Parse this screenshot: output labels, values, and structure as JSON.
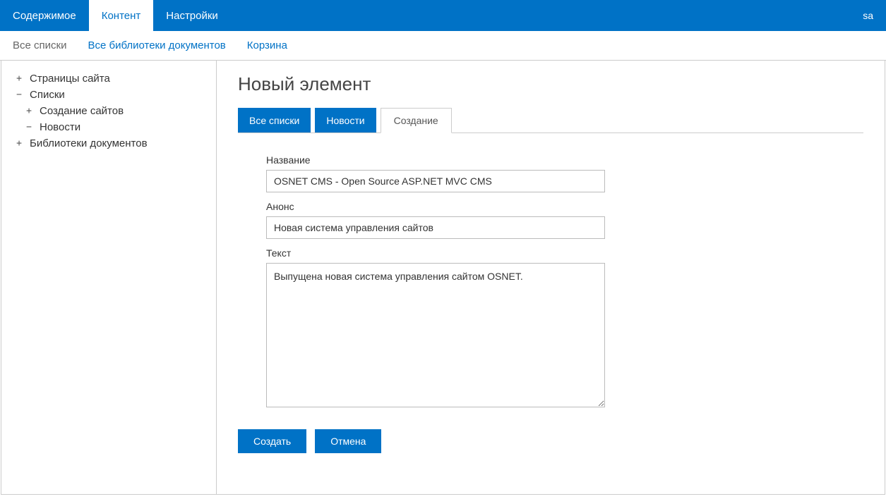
{
  "topbar": {
    "tabs": [
      {
        "label": "Содержимое"
      },
      {
        "label": "Контент"
      },
      {
        "label": "Настройки"
      }
    ],
    "user": "sa"
  },
  "subbar": {
    "links": [
      {
        "label": "Все списки",
        "muted": true
      },
      {
        "label": "Все библиотеки документов"
      },
      {
        "label": "Корзина"
      }
    ]
  },
  "sidebar": {
    "items": [
      {
        "icon": "+",
        "label": "Страницы сайта",
        "level": 1
      },
      {
        "icon": "−",
        "label": "Списки",
        "level": 1
      },
      {
        "icon": "+",
        "label": "Создание сайтов",
        "level": 2
      },
      {
        "icon": "−",
        "label": "Новости",
        "level": 2
      },
      {
        "icon": "+",
        "label": "Библиотеки документов",
        "level": 1
      }
    ]
  },
  "main": {
    "title": "Новый элемент",
    "breadcrumb": {
      "all_lists": "Все списки",
      "news": "Новости",
      "create": "Создание"
    },
    "form": {
      "name_label": "Название",
      "name_value": "OSNET CMS - Open Source ASP.NET MVC CMS",
      "announce_label": "Анонс",
      "announce_value": "Новая система управления сайтов",
      "text_label": "Текст",
      "text_value": "Выпущена новая система управления сайтом OSNET."
    },
    "actions": {
      "create": "Создать",
      "cancel": "Отмена"
    }
  }
}
